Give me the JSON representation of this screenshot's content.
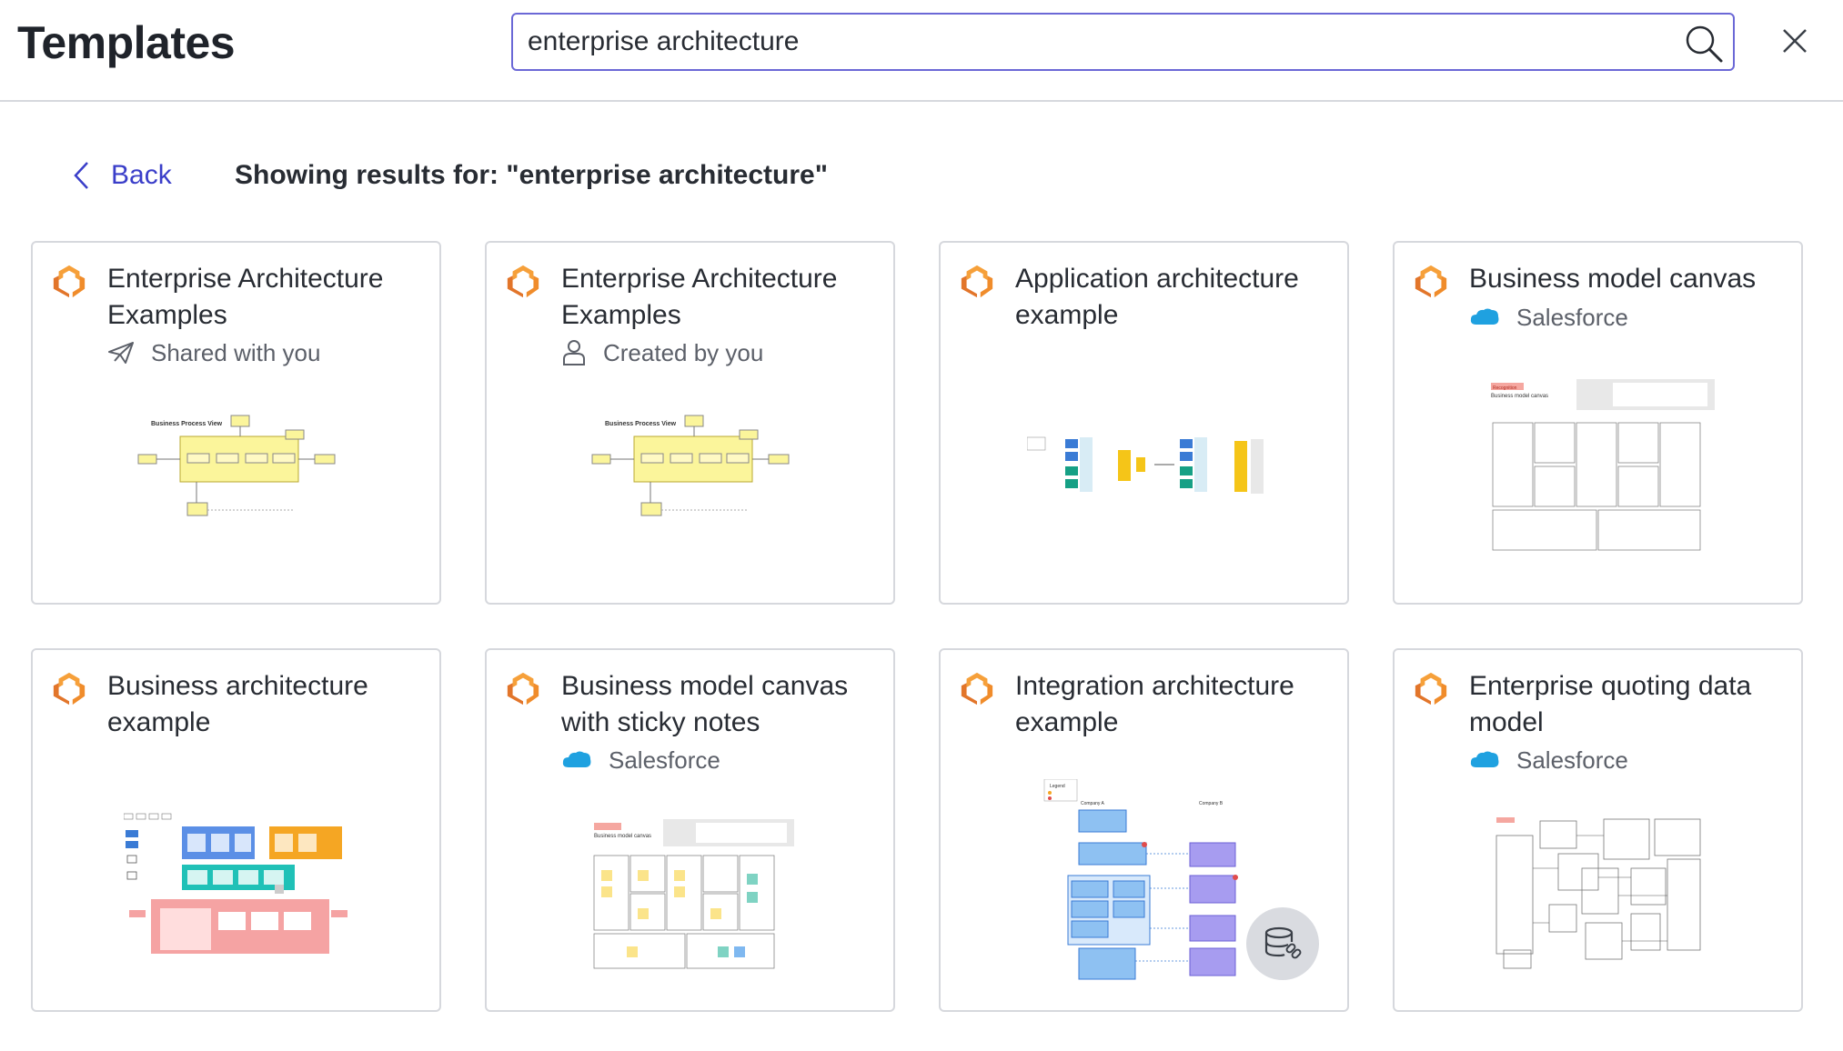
{
  "header": {
    "title": "Templates"
  },
  "search": {
    "value": "enterprise architecture"
  },
  "nav": {
    "back_label": "Back",
    "results_text": "Showing results for: \"enterprise architecture\""
  },
  "colors": {
    "accent": "#3a3ec9",
    "search_border": "#6b68d6",
    "logo_orange": "#f08c2b",
    "salesforce_blue": "#1fa1e0"
  },
  "cards": [
    {
      "title": "Enterprise Architecture Examples",
      "meta": "Shared with you",
      "meta_icon": "share-icon"
    },
    {
      "title": "Enterprise Architecture Examples",
      "meta": "Created by you",
      "meta_icon": "person-icon"
    },
    {
      "title": "Application architecture example",
      "meta": "",
      "meta_icon": ""
    },
    {
      "title": "Business model canvas",
      "meta": "Salesforce",
      "meta_icon": "salesforce-icon"
    },
    {
      "title": "Business architecture example",
      "meta": "",
      "meta_icon": ""
    },
    {
      "title": "Business model canvas with sticky notes",
      "meta": "Salesforce",
      "meta_icon": "salesforce-icon"
    },
    {
      "title": "Integration architecture example",
      "meta": "",
      "meta_icon": ""
    },
    {
      "title": "Enterprise quoting data model",
      "meta": "Salesforce",
      "meta_icon": "salesforce-icon"
    }
  ],
  "thumb_text": {
    "bpv": "Business Process View",
    "bmc_tag": "Recognition",
    "bmc_title": "Business model canvas",
    "integ_legend": "Legend",
    "company_a": "Company A",
    "company_b": "Company B"
  }
}
